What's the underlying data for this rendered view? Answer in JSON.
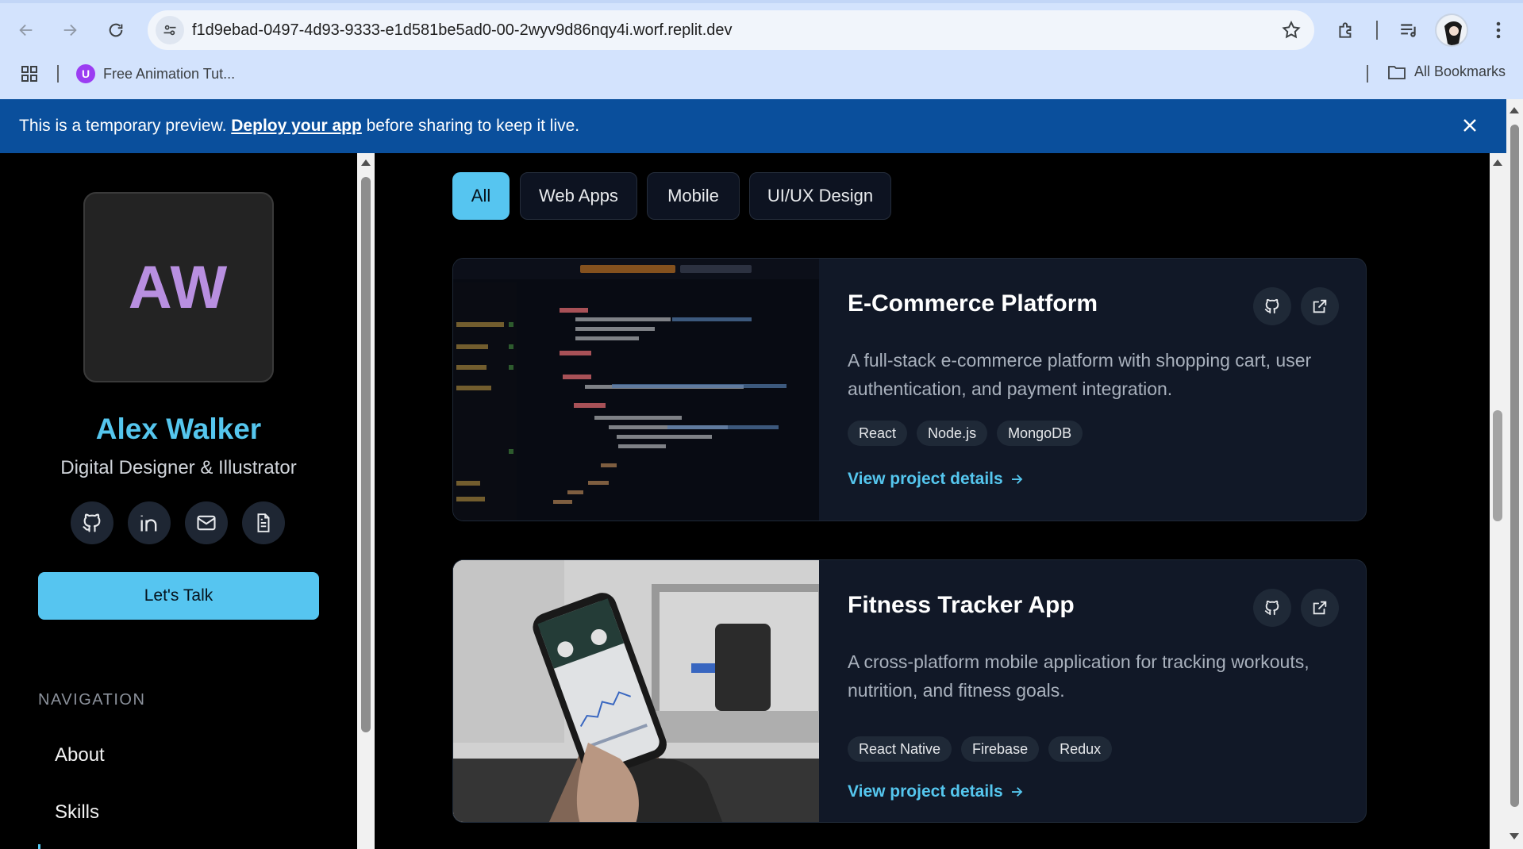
{
  "browser": {
    "url": "f1d9ebad-0497-4d93-9333-e1d581be5ad0-00-2wyv9d86nqy4i.worf.replit.dev",
    "bookmarks": [
      {
        "label": "Free Animation Tut...",
        "icon": "purple-u-favicon"
      }
    ],
    "all_bookmarks_label": "All Bookmarks"
  },
  "banner": {
    "text_before": "This is a temporary preview. ",
    "link_text": "Deploy your app",
    "text_after": " before sharing to keep it live.",
    "bg_color": "#0a4f9c"
  },
  "sidebar": {
    "monogram": "AW",
    "name": "Alex Walker",
    "role": "Digital Designer & Illustrator",
    "social": [
      "github-icon",
      "linkedin-icon",
      "mail-icon",
      "resume-icon"
    ],
    "cta_label": "Let's Talk",
    "nav_heading": "NAVIGATION",
    "nav_items": [
      "About",
      "Skills"
    ]
  },
  "filters": [
    {
      "label": "All",
      "active": true
    },
    {
      "label": "Web Apps",
      "active": false
    },
    {
      "label": "Mobile",
      "active": false
    },
    {
      "label": "UI/UX Design",
      "active": false
    }
  ],
  "projects": [
    {
      "title": "E-Commerce Platform",
      "description": "A full-stack e-commerce platform with shopping cart, user authentication, and payment integration.",
      "tags": [
        "React",
        "Node.js",
        "MongoDB"
      ],
      "link_label": "View project details",
      "image": "code-editor-screenshot"
    },
    {
      "title": "Fitness Tracker App",
      "description": "A cross-platform mobile application for tracking workouts, nutrition, and fitness goals.",
      "tags": [
        "React Native",
        "Firebase",
        "Redux"
      ],
      "link_label": "View project details",
      "image": "phone-in-hand-photo"
    }
  ],
  "colors": {
    "accent": "#56c5f0",
    "card_bg": "#111827",
    "monogram": "#b88fe0"
  }
}
